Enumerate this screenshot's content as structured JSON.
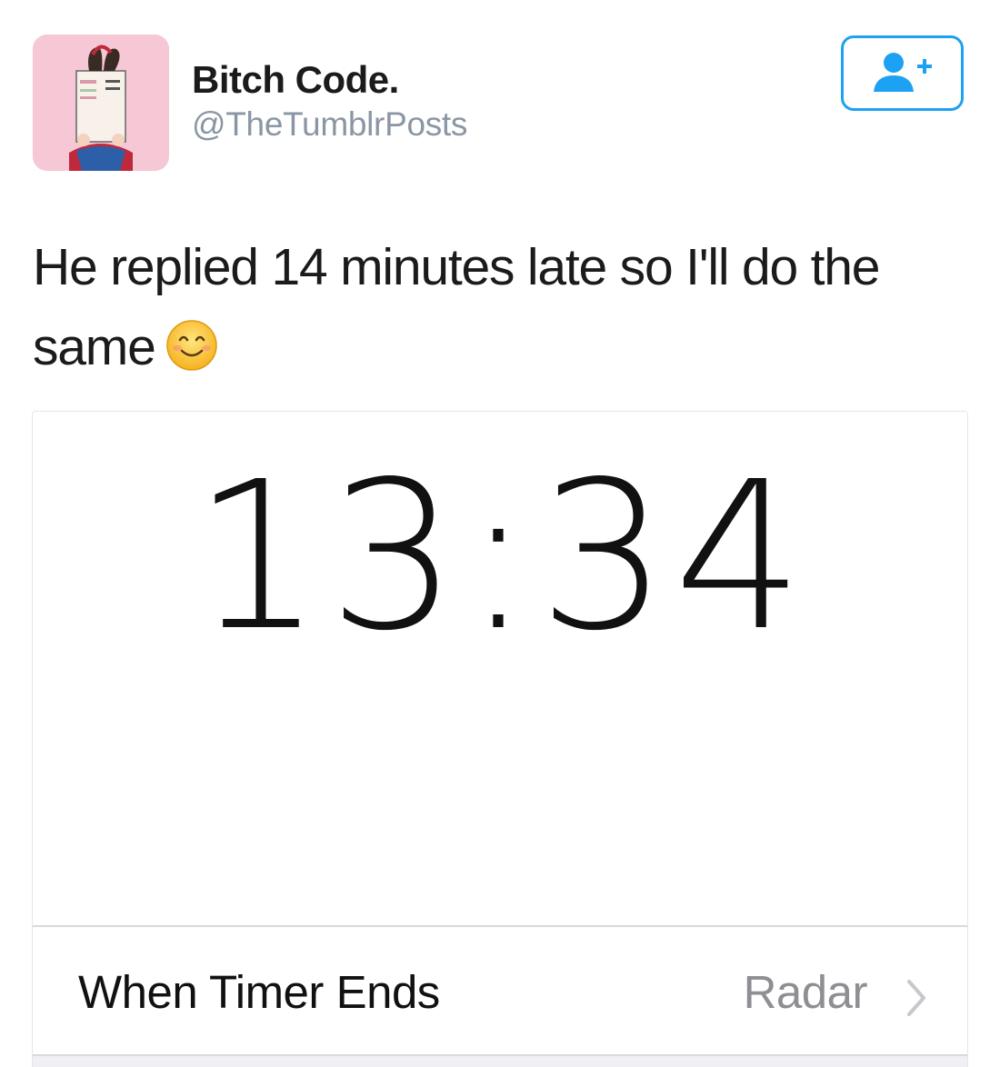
{
  "tweet": {
    "author": {
      "display_name": "Bitch Code.",
      "handle": "@TheTumblrPosts",
      "avatar_icon": "avatar-illustration"
    },
    "follow_button": {
      "icon": "add-user-icon",
      "color": "#1da1f2"
    },
    "text": "He replied 14 minutes late so I'll do the same",
    "emoji": "smiling-face-emoji",
    "attached_screenshot": {
      "timer_value": "13:34",
      "setting_row": {
        "label": "When Timer Ends",
        "value": "Radar",
        "icon": "chevron-right-icon"
      }
    }
  }
}
